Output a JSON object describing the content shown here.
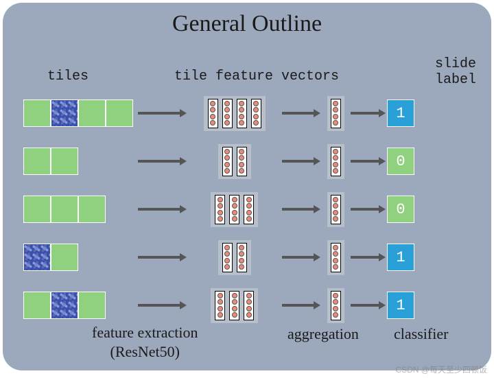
{
  "title": "General Outline",
  "headers": {
    "tiles": "tiles",
    "feature_vectors": "tile feature vectors",
    "slide_label_line1": "slide",
    "slide_label_line2": "label"
  },
  "bottom": {
    "feature_extraction_line1": "feature extraction",
    "feature_extraction_line2": "(ResNet50)",
    "aggregation": "aggregation",
    "classifier": "classifier"
  },
  "rows": [
    {
      "tiles": [
        "green",
        "blue",
        "green",
        "green"
      ],
      "n_vectors": 4,
      "label": "1",
      "label_color": "blue"
    },
    {
      "tiles": [
        "green",
        "green"
      ],
      "n_vectors": 2,
      "label": "0",
      "label_color": "green"
    },
    {
      "tiles": [
        "green",
        "green",
        "green"
      ],
      "n_vectors": 3,
      "label": "0",
      "label_color": "green"
    },
    {
      "tiles": [
        "blue",
        "green"
      ],
      "n_vectors": 2,
      "label": "1",
      "label_color": "blue"
    },
    {
      "tiles": [
        "green",
        "blue",
        "green"
      ],
      "n_vectors": 3,
      "label": "1",
      "label_color": "blue"
    }
  ],
  "watermark": "CSDN @每天至少四顿饭"
}
